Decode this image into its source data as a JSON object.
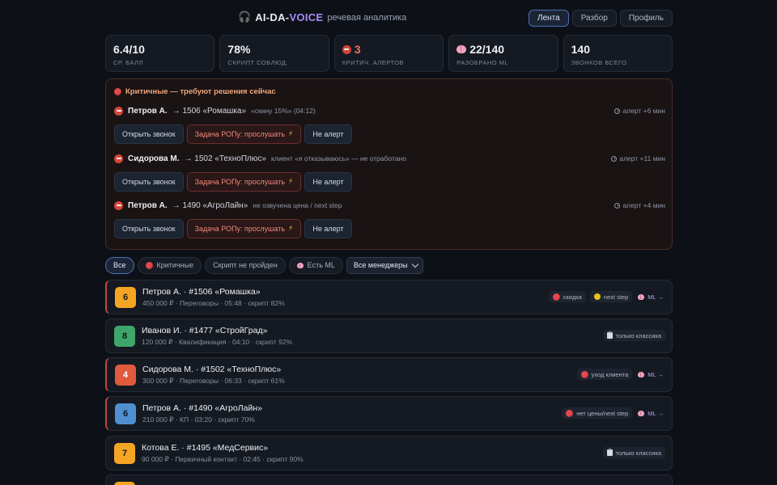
{
  "header": {
    "icon": "headphones-icon",
    "brand_a": "AI-DA-",
    "brand_b": "VOICE",
    "subtitle": "речевая аналитика",
    "nav": [
      {
        "label": "Лента",
        "active": true
      },
      {
        "label": "Разбор",
        "active": false
      },
      {
        "label": "Профиль",
        "active": false
      }
    ]
  },
  "stats": [
    {
      "value": "6.4/10",
      "label": "СР. БАЛЛ"
    },
    {
      "value": "78%",
      "label": "СКРИПТ СОБЛЮД."
    },
    {
      "value": "3",
      "label": "КРИТИЧ. АЛЕРТОВ",
      "icon": "no-entry-icon"
    },
    {
      "value": "22/140",
      "label": "РАЗОБРАНО ML",
      "icon": "brain-icon"
    },
    {
      "value": "140",
      "label": "ЗВОНКОВ ВСЕГО"
    }
  ],
  "critical": {
    "title": "Критичные — требуют решения сейчас",
    "items": [
      {
        "manager": "Петров А.",
        "deal": "→ 1506 «Ромашка»",
        "note": "«скину 15%» (04:12)",
        "alert": "алерт +6 мин"
      },
      {
        "manager": "Сидорова М.",
        "deal": "→ 1502 «ТехноПлюс»",
        "note": "клиент «я отказываюсь» — не отработано",
        "alert": "алерт +11 мин"
      },
      {
        "manager": "Петров А.",
        "deal": "→ 1490 «АгроЛайн»",
        "note": "не озвучена цена / next step",
        "alert": "алерт +4 мин"
      }
    ],
    "btn_open": "Открыть звонок",
    "btn_task": "Задача РОПу: прослушать",
    "btn_not_alert": "Не алерт"
  },
  "filters": {
    "all": "Все",
    "critical": "Критичные",
    "script_failed": "Скрипт не пройден",
    "has_ml": "Есть ML",
    "managers_select": "Все менеджеры"
  },
  "calls": [
    {
      "score": "6",
      "score_color": "orange",
      "critical": true,
      "title": "Петров А. · #1506 «Ромашка»",
      "meta": "450 000 ₽ · Переговоры · 05:48 · скрипт 82%",
      "tags": [
        {
          "type": "red",
          "text": "скидка"
        },
        {
          "type": "yellow",
          "text": "next step"
        },
        {
          "type": "ml",
          "text": "ML →"
        }
      ]
    },
    {
      "score": "8",
      "score_color": "green",
      "critical": false,
      "title": "Иванов И. · #1477 «СтройГрад»",
      "meta": "120 000 ₽ · Квалификация · 04:10 · скрипт 92%",
      "tags": [
        {
          "type": "clip",
          "text": "только классика"
        }
      ]
    },
    {
      "score": "4",
      "score_color": "red",
      "critical": true,
      "title": "Сидорова М. · #1502 «ТехноПлюс»",
      "meta": "300 000 ₽ · Переговоры · 06:33 · скрипт 61%",
      "tags": [
        {
          "type": "red",
          "text": "уход клиента"
        },
        {
          "type": "ml",
          "text": "ML →"
        }
      ]
    },
    {
      "score": "6",
      "score_color": "blue",
      "critical": true,
      "title": "Петров А. · #1490 «АгроЛайн»",
      "meta": "210 000 ₽ · КП · 03:20 · скрипт 70%",
      "tags": [
        {
          "type": "red",
          "text": "нет цены/next step"
        },
        {
          "type": "ml",
          "text": "ML →"
        }
      ]
    },
    {
      "score": "7",
      "score_color": "orange",
      "critical": false,
      "title": "Котова Е. · #1495 «МедСервис»",
      "meta": "90 000 ₽ · Первичный контакт · 02:45 · скрипт 90%",
      "tags": [
        {
          "type": "clip",
          "text": "только классика"
        }
      ]
    },
    {
      "score": "",
      "score_color": "orange",
      "critical": false,
      "title": "",
      "meta": "",
      "tags": []
    }
  ]
}
